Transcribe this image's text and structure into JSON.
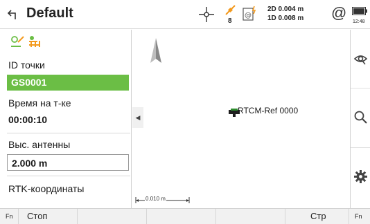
{
  "titlebar": {
    "title": "Default",
    "satellite_count": "8",
    "precision_2d": "2D 0.004 m",
    "precision_1d": "1D 0.008 m",
    "at_symbol": "@",
    "time": "12:48"
  },
  "left_panel": {
    "point_id_label": "ID точки",
    "point_id_value": "GS0001",
    "time_label": "Время на т-ке",
    "time_value": "00:00:10",
    "antenna_label": "Выс. антенны",
    "antenna_value": "2.000 m",
    "rtk_label": "RTK-координаты"
  },
  "map": {
    "station_label": "RTCM-Ref 0000",
    "scale_label": "0.010 m",
    "collapse_glyph": "◀"
  },
  "softkeys": {
    "fn_left": "Fn",
    "stop": "Стоп",
    "page": "Стр",
    "fn_right": "Fn"
  },
  "colors": {
    "accent_green": "#6bbe45",
    "gnss_orange": "#f39a1e"
  },
  "icons": [
    "back-icon",
    "crosshair-icon",
    "satellite-icon",
    "rtk-link-icon",
    "battery-icon",
    "north-arrow-icon",
    "eye-icon",
    "search-icon",
    "gear-icon",
    "base-station-icon"
  ]
}
